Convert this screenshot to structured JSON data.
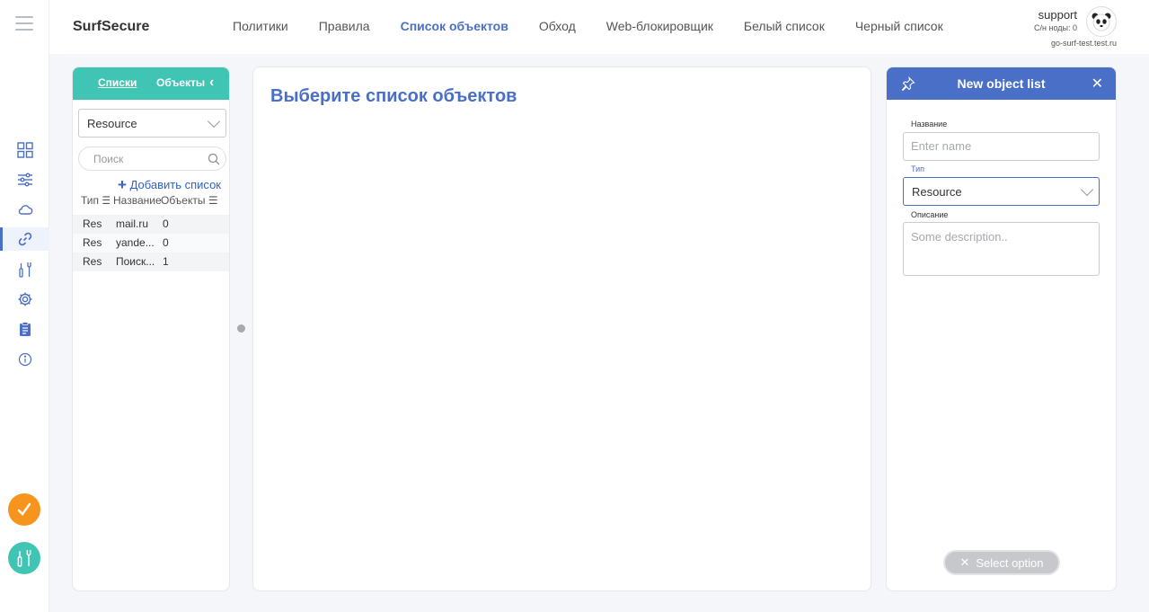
{
  "app": {
    "brand": "SurfSecure"
  },
  "nav": [
    {
      "label": "Политики"
    },
    {
      "label": "Правила"
    },
    {
      "label": "Список объектов"
    },
    {
      "label": "Обход"
    },
    {
      "label": "Web-блокировщик"
    },
    {
      "label": "Белый список"
    },
    {
      "label": "Черный список"
    }
  ],
  "user": {
    "name": "support",
    "nodes": "С/н ноды: 0",
    "host": "go-surf-test.test.ru"
  },
  "left_panel": {
    "tab_lists": "Списки",
    "tab_objects": "Объекты",
    "type_select": "Resource",
    "search_placeholder": "Поиск",
    "add_list": "Добавить список",
    "columns": [
      "Тип ☰",
      "Название",
      "Объекты ☰"
    ],
    "rows": [
      {
        "type": "Res",
        "name": "mail.ru",
        "count": "0"
      },
      {
        "type": "Res",
        "name": "yande...",
        "count": "0"
      },
      {
        "type": "Res",
        "name": "Поиск...",
        "count": "1"
      }
    ]
  },
  "main": {
    "title": "Выберите список объектов"
  },
  "right_panel": {
    "title": "New object list",
    "name_label": "Название",
    "name_placeholder": "Enter name",
    "type_label": "Тип",
    "type_value": "Resource",
    "desc_label": "Описание",
    "desc_placeholder": "Some description..",
    "select_option": "Select option"
  },
  "colors": {
    "accent": "#4a6fc7",
    "teal": "#40c4b3",
    "orange": "#f7941d"
  }
}
